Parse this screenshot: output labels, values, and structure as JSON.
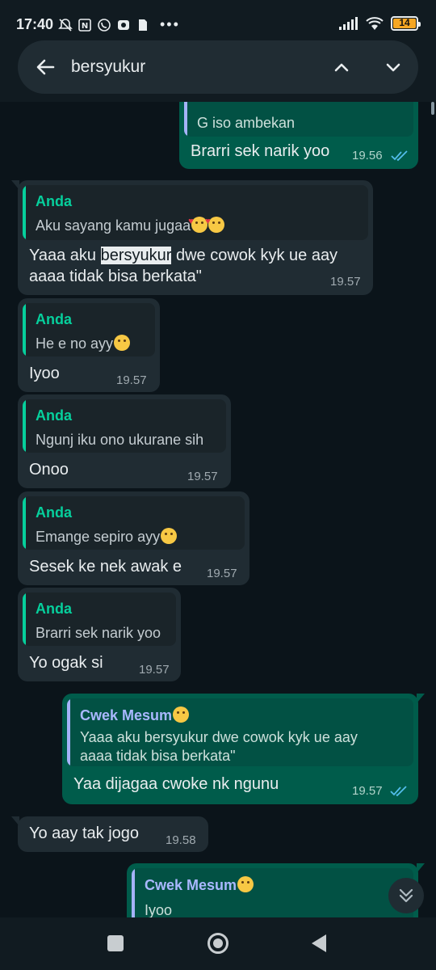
{
  "status_bar": {
    "time": "17:40",
    "battery": "14",
    "icons": [
      "mute-icon",
      "nfc-icon",
      "whatsapp-icon",
      "camera-icon",
      "file-icon",
      "more-dots-icon",
      "signal-icon",
      "wifi-icon",
      "battery-icon"
    ],
    "dots": "•••"
  },
  "search": {
    "query": "bersyukur"
  },
  "messages": [
    {
      "direction": "out",
      "quote_text": "G iso ambekan",
      "text": "Brarri sek narik yoo",
      "time": "19.56"
    },
    {
      "direction": "in",
      "quote_name": "Anda",
      "quote_text": "Aku sayang kamu jugaa",
      "text_before": "Yaaa aku ",
      "text_highlight": "bersyukur",
      "text_after": " dwe cowok kyk ue aay",
      "text_line2": "aaaa tidak bisa berkata\"",
      "time": "19.57"
    },
    {
      "direction": "in",
      "quote_name": "Anda",
      "quote_text": "He e no ayy",
      "text": "Iyoo",
      "time": "19.57"
    },
    {
      "direction": "in",
      "quote_name": "Anda",
      "quote_text": "Ngunj iku ono ukurane sih",
      "text": "Onoo",
      "time": "19.57"
    },
    {
      "direction": "in",
      "quote_name": "Anda",
      "quote_text": "Emange sepiro ayy",
      "text": "Sesek ke nek awak e",
      "time": "19.57"
    },
    {
      "direction": "in",
      "quote_name": "Anda",
      "quote_text": "Brarri sek narik yoo",
      "text": "Yo ogak si",
      "time": "19.57"
    },
    {
      "direction": "out",
      "quote_name": "Cwek Mesum",
      "quote_text_line1": "Yaaa aku bersyukur dwe cowok kyk ue aay",
      "quote_text_line2": "aaaa tidak bisa berkata\"",
      "text": "Yaa dijagaa cwoke nk ngunu",
      "time": "19.57"
    },
    {
      "direction": "in",
      "text": "Yo aay tak jogo",
      "time": "19.58"
    },
    {
      "direction": "out",
      "quote_name": "Cwek Mesum",
      "quote_text": "Iyoo"
    }
  ],
  "colors": {
    "background": "#0b141a",
    "incoming_bubble": "#202c33",
    "outgoing_bubble": "#005c4b",
    "quote_name_self": "#06cf9c",
    "quote_name_other": "#a9b8ff",
    "read_ticks": "#53bdeb"
  }
}
